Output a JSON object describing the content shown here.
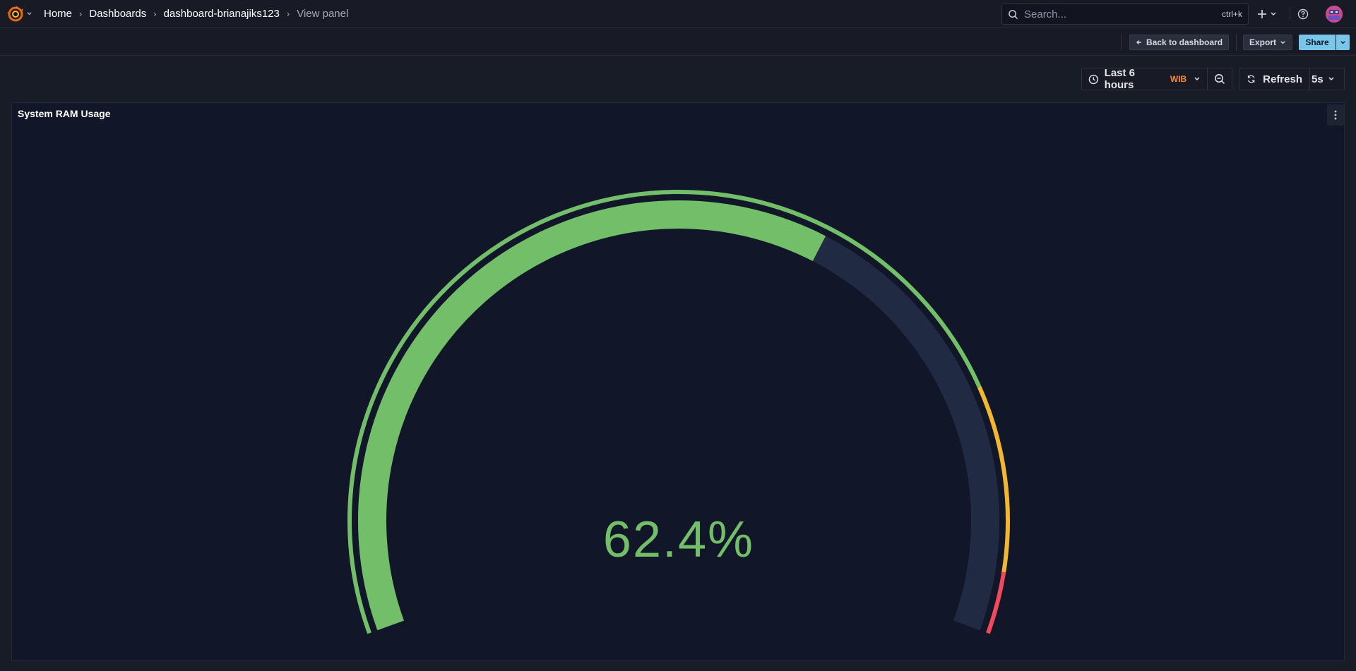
{
  "nav": {
    "breadcrumbs": [
      "Home",
      "Dashboards",
      "dashboard-brianajiks123",
      "View panel"
    ],
    "search_placeholder": "Search...",
    "search_shortcut": "ctrl+k"
  },
  "toolbar": {
    "back_label": "Back to dashboard",
    "export_label": "Export",
    "share_label": "Share"
  },
  "time": {
    "range_label": "Last 6 hours",
    "timezone": "WIB",
    "refresh_label": "Refresh",
    "interval": "5s"
  },
  "panel": {
    "title": "System RAM Usage",
    "value_text": "62.4%",
    "value": 62.4,
    "min": 0,
    "max": 100,
    "thresholds": [
      {
        "from": 0,
        "color": "#73bf69"
      },
      {
        "from": 80,
        "color": "#f2b731"
      },
      {
        "from": 95,
        "color": "#f2495c"
      }
    ],
    "value_color": "#73bf69",
    "track_color": "#202a42"
  }
}
